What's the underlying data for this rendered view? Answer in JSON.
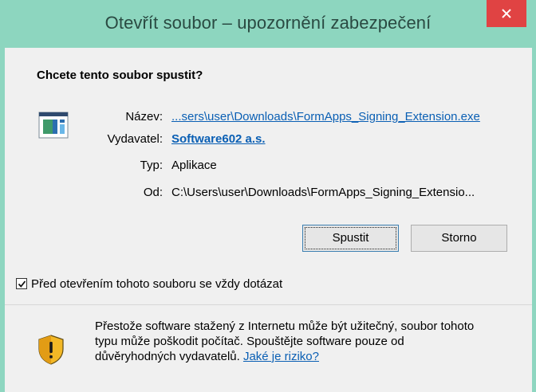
{
  "window": {
    "title": "Otevřít soubor – upozornění zabezpečení"
  },
  "dialog": {
    "question": "Chcete tento soubor spustit?",
    "fields": {
      "name_label": "Název:",
      "name_value": "...sers\\user\\Downloads\\FormApps_Signing_Extension.exe",
      "publisher_label": "Vydavatel:",
      "publisher_value": "Software602 a.s.",
      "type_label": "Typ:",
      "type_value": "Aplikace",
      "from_label": "Od:",
      "from_value": "C:\\Users\\user\\Downloads\\FormApps_Signing_Extensio..."
    },
    "buttons": {
      "run": "Spustit",
      "cancel": "Storno"
    },
    "checkbox": {
      "label": "Před otevřením tohoto souboru se vždy dotázat",
      "checked": true
    },
    "warning": {
      "line1": "Přestože software stažený z Internetu může být užitečný, soubor tohoto",
      "line2": "typu může poškodit počítač. Spouštějte software pouze od",
      "line3_text": "důvěryhodných vydavatelů.",
      "link": "Jaké je riziko?"
    }
  },
  "icons": {
    "close": "close-icon",
    "file": "executable-file-icon",
    "checkmark": "checkmark-icon",
    "shield": "security-shield-icon"
  },
  "colors": {
    "titlebar": "#8dd6bf",
    "close_button": "#e04343",
    "link": "#0a5fb4",
    "dialog_background": "#f0f0f0"
  }
}
